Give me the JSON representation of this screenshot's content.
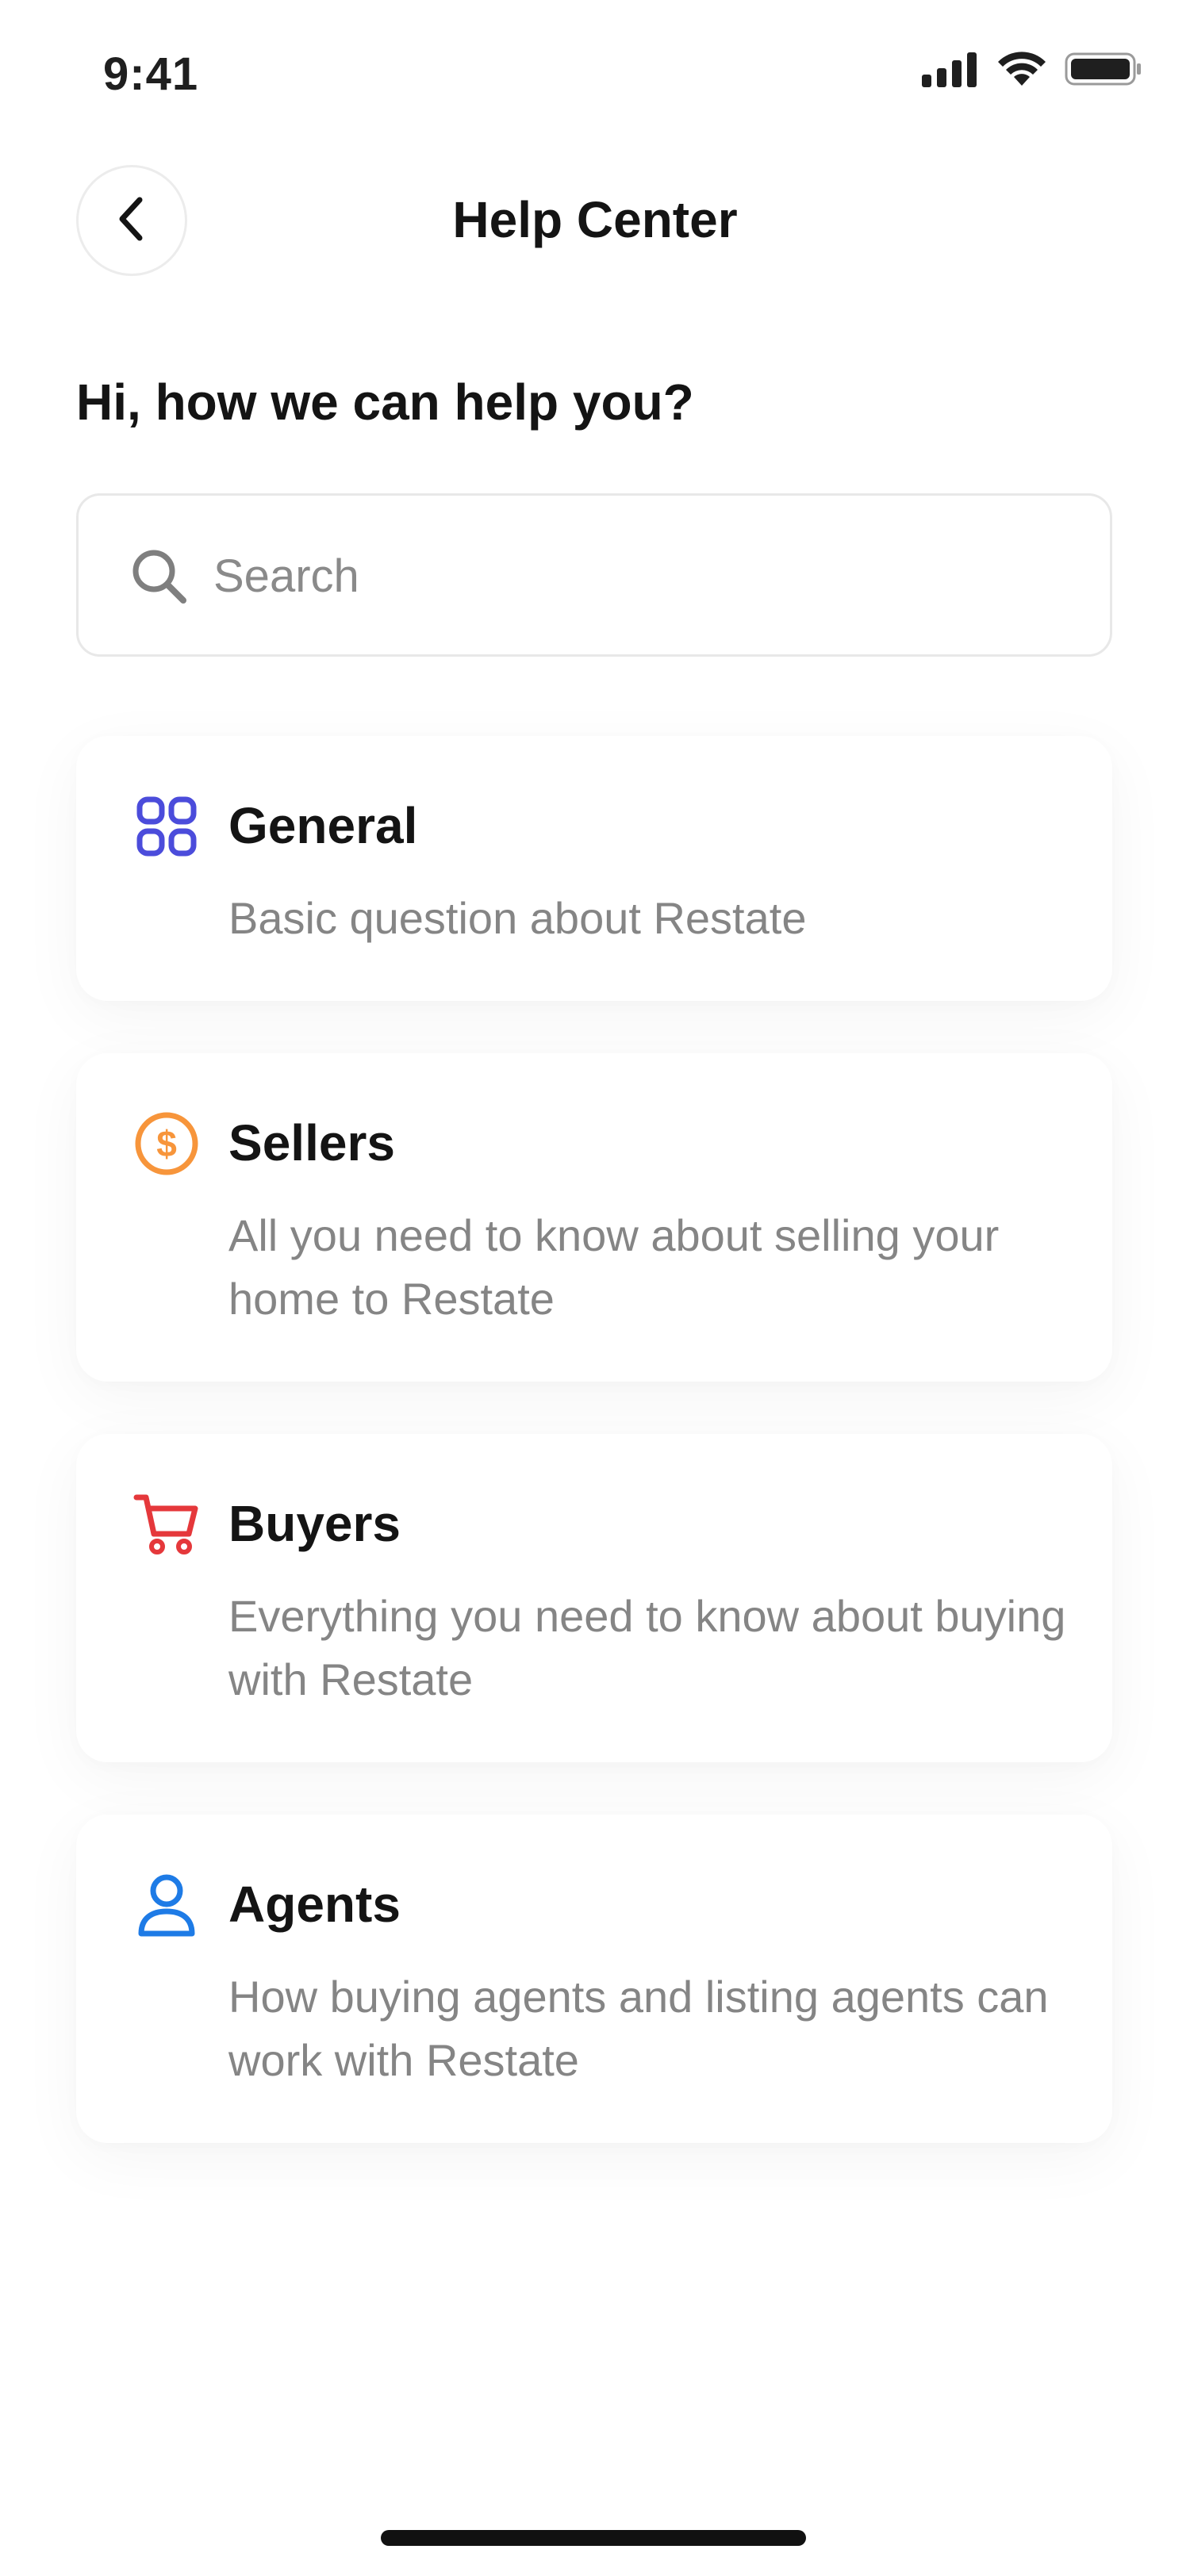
{
  "status_bar": {
    "time": "9:41"
  },
  "header": {
    "title": "Help Center"
  },
  "greeting": "Hi, how we can help you?",
  "search": {
    "placeholder": "Search",
    "value": ""
  },
  "categories": [
    {
      "title": "General",
      "description": "Basic question about Restate",
      "icon": "grid-icon",
      "color": "#4B4CDB"
    },
    {
      "title": "Sellers",
      "description": "All you need to know about selling your home to Restate",
      "icon": "dollar-coin-icon",
      "color": "#F7953B"
    },
    {
      "title": "Buyers",
      "description": "Everything you need to know about buying with Restate",
      "icon": "cart-icon",
      "color": "#E5383B"
    },
    {
      "title": "Agents",
      "description": "How buying agents and listing agents can work with Restate",
      "icon": "user-icon",
      "color": "#1E7BE6"
    }
  ]
}
